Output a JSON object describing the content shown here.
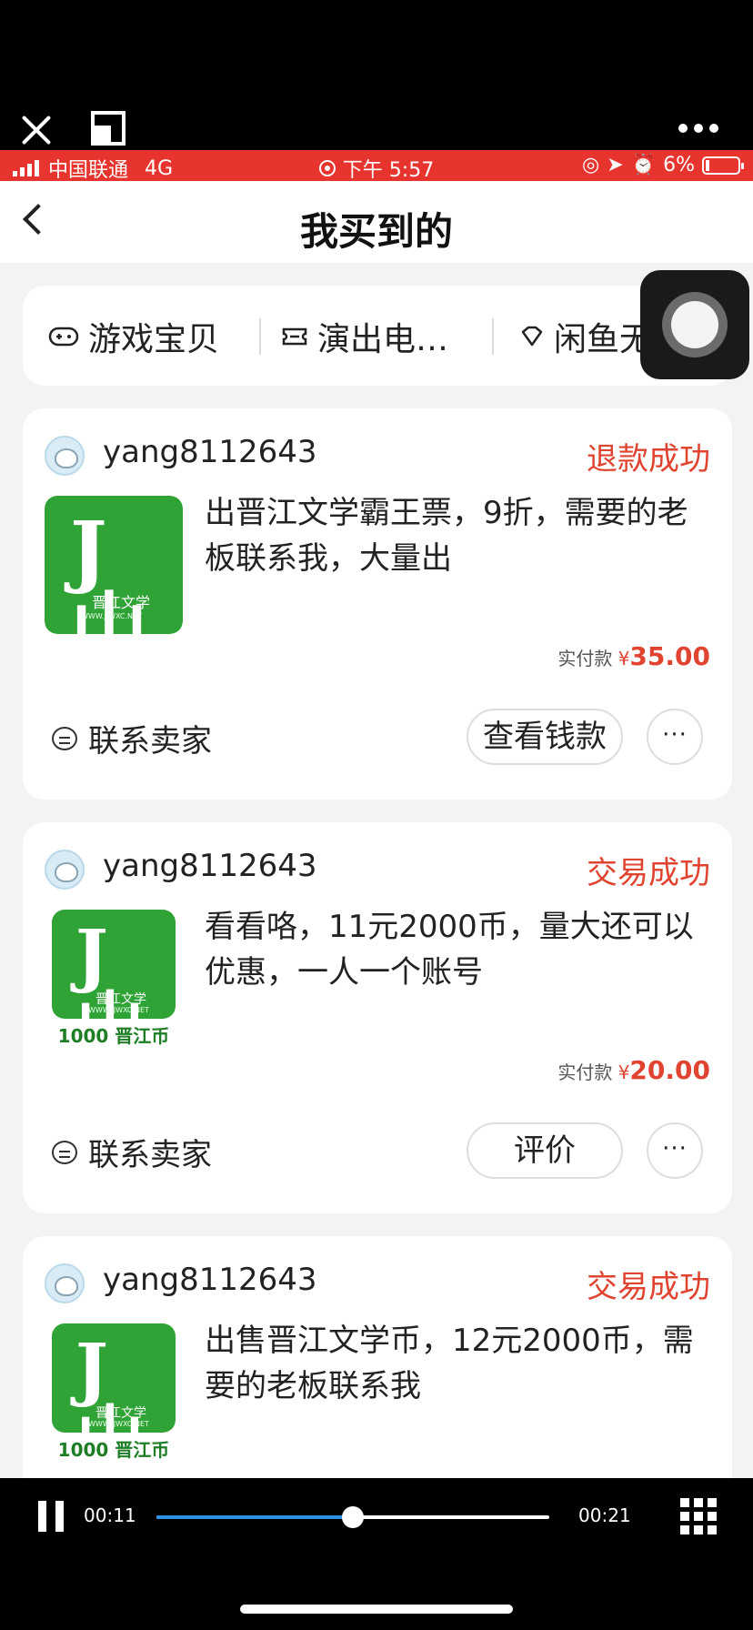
{
  "status_bar": {
    "carrier": "中国联通",
    "network": "4G",
    "time": "下午 5:57",
    "battery": "6%"
  },
  "nav": {
    "title": "我买到的"
  },
  "filters": [
    {
      "label": "游戏宝贝",
      "icon": "gamepad-icon"
    },
    {
      "label": "演出电…",
      "icon": "ticket-icon"
    },
    {
      "label": "闲鱼无",
      "icon": "diamond-icon"
    }
  ],
  "orders": [
    {
      "seller": "yang8112643",
      "status": "退款成功",
      "description": "出晋江文学霸王票，9折，需要的老板联系我，大量出",
      "price_label": "实付款",
      "currency": "¥",
      "amount": "35.00",
      "contact_label": "联系卖家",
      "action_label": "查看钱款",
      "more_label": "···",
      "thumb_label": "晋江文学",
      "thumb_url": "WWW.JJWXC.NET"
    },
    {
      "seller": "yang8112643",
      "status": "交易成功",
      "description": "看看咯，11元2000币，量大还可以优惠，一人一个账号",
      "price_label": "实付款",
      "currency": "¥",
      "amount": "20.00",
      "contact_label": "联系卖家",
      "action_label": "评价",
      "more_label": "···",
      "thumb_label": "晋江文学",
      "thumb_url": "WWW.JJWXC.NET",
      "thumb_coin": "1000 晋江币"
    },
    {
      "seller": "yang8112643",
      "status": "交易成功",
      "description": "出售晋江文学币，12元2000币，需要的老板联系我",
      "thumb_label": "晋江文学",
      "thumb_url": "WWW.JJWXC.NET",
      "thumb_coin": "1000 晋江币"
    }
  ],
  "player": {
    "current_time": "00:11",
    "total_time": "00:21",
    "progress": 0.5
  },
  "colors": {
    "status_bar": "#e8342e",
    "accent_red": "#e0432f",
    "progress_blue": "#2e8fe6",
    "logo_green": "#2fa336"
  }
}
